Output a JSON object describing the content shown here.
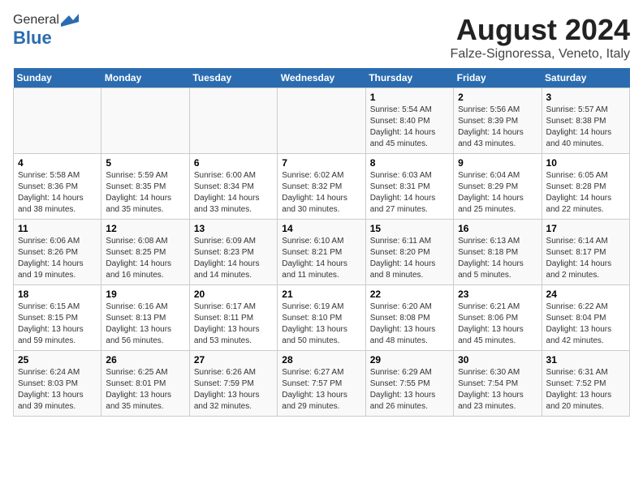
{
  "header": {
    "logo_general": "General",
    "logo_blue": "Blue",
    "main_title": "August 2024",
    "subtitle": "Falze-Signoressa, Veneto, Italy"
  },
  "calendar": {
    "days_of_week": [
      "Sunday",
      "Monday",
      "Tuesday",
      "Wednesday",
      "Thursday",
      "Friday",
      "Saturday"
    ],
    "weeks": [
      [
        {
          "day": "",
          "text": ""
        },
        {
          "day": "",
          "text": ""
        },
        {
          "day": "",
          "text": ""
        },
        {
          "day": "",
          "text": ""
        },
        {
          "day": "1",
          "text": "Sunrise: 5:54 AM\nSunset: 8:40 PM\nDaylight: 14 hours and 45 minutes."
        },
        {
          "day": "2",
          "text": "Sunrise: 5:56 AM\nSunset: 8:39 PM\nDaylight: 14 hours and 43 minutes."
        },
        {
          "day": "3",
          "text": "Sunrise: 5:57 AM\nSunset: 8:38 PM\nDaylight: 14 hours and 40 minutes."
        }
      ],
      [
        {
          "day": "4",
          "text": "Sunrise: 5:58 AM\nSunset: 8:36 PM\nDaylight: 14 hours and 38 minutes."
        },
        {
          "day": "5",
          "text": "Sunrise: 5:59 AM\nSunset: 8:35 PM\nDaylight: 14 hours and 35 minutes."
        },
        {
          "day": "6",
          "text": "Sunrise: 6:00 AM\nSunset: 8:34 PM\nDaylight: 14 hours and 33 minutes."
        },
        {
          "day": "7",
          "text": "Sunrise: 6:02 AM\nSunset: 8:32 PM\nDaylight: 14 hours and 30 minutes."
        },
        {
          "day": "8",
          "text": "Sunrise: 6:03 AM\nSunset: 8:31 PM\nDaylight: 14 hours and 27 minutes."
        },
        {
          "day": "9",
          "text": "Sunrise: 6:04 AM\nSunset: 8:29 PM\nDaylight: 14 hours and 25 minutes."
        },
        {
          "day": "10",
          "text": "Sunrise: 6:05 AM\nSunset: 8:28 PM\nDaylight: 14 hours and 22 minutes."
        }
      ],
      [
        {
          "day": "11",
          "text": "Sunrise: 6:06 AM\nSunset: 8:26 PM\nDaylight: 14 hours and 19 minutes."
        },
        {
          "day": "12",
          "text": "Sunrise: 6:08 AM\nSunset: 8:25 PM\nDaylight: 14 hours and 16 minutes."
        },
        {
          "day": "13",
          "text": "Sunrise: 6:09 AM\nSunset: 8:23 PM\nDaylight: 14 hours and 14 minutes."
        },
        {
          "day": "14",
          "text": "Sunrise: 6:10 AM\nSunset: 8:21 PM\nDaylight: 14 hours and 11 minutes."
        },
        {
          "day": "15",
          "text": "Sunrise: 6:11 AM\nSunset: 8:20 PM\nDaylight: 14 hours and 8 minutes."
        },
        {
          "day": "16",
          "text": "Sunrise: 6:13 AM\nSunset: 8:18 PM\nDaylight: 14 hours and 5 minutes."
        },
        {
          "day": "17",
          "text": "Sunrise: 6:14 AM\nSunset: 8:17 PM\nDaylight: 14 hours and 2 minutes."
        }
      ],
      [
        {
          "day": "18",
          "text": "Sunrise: 6:15 AM\nSunset: 8:15 PM\nDaylight: 13 hours and 59 minutes."
        },
        {
          "day": "19",
          "text": "Sunrise: 6:16 AM\nSunset: 8:13 PM\nDaylight: 13 hours and 56 minutes."
        },
        {
          "day": "20",
          "text": "Sunrise: 6:17 AM\nSunset: 8:11 PM\nDaylight: 13 hours and 53 minutes."
        },
        {
          "day": "21",
          "text": "Sunrise: 6:19 AM\nSunset: 8:10 PM\nDaylight: 13 hours and 50 minutes."
        },
        {
          "day": "22",
          "text": "Sunrise: 6:20 AM\nSunset: 8:08 PM\nDaylight: 13 hours and 48 minutes."
        },
        {
          "day": "23",
          "text": "Sunrise: 6:21 AM\nSunset: 8:06 PM\nDaylight: 13 hours and 45 minutes."
        },
        {
          "day": "24",
          "text": "Sunrise: 6:22 AM\nSunset: 8:04 PM\nDaylight: 13 hours and 42 minutes."
        }
      ],
      [
        {
          "day": "25",
          "text": "Sunrise: 6:24 AM\nSunset: 8:03 PM\nDaylight: 13 hours and 39 minutes."
        },
        {
          "day": "26",
          "text": "Sunrise: 6:25 AM\nSunset: 8:01 PM\nDaylight: 13 hours and 35 minutes."
        },
        {
          "day": "27",
          "text": "Sunrise: 6:26 AM\nSunset: 7:59 PM\nDaylight: 13 hours and 32 minutes."
        },
        {
          "day": "28",
          "text": "Sunrise: 6:27 AM\nSunset: 7:57 PM\nDaylight: 13 hours and 29 minutes."
        },
        {
          "day": "29",
          "text": "Sunrise: 6:29 AM\nSunset: 7:55 PM\nDaylight: 13 hours and 26 minutes."
        },
        {
          "day": "30",
          "text": "Sunrise: 6:30 AM\nSunset: 7:54 PM\nDaylight: 13 hours and 23 minutes."
        },
        {
          "day": "31",
          "text": "Sunrise: 6:31 AM\nSunset: 7:52 PM\nDaylight: 13 hours and 20 minutes."
        }
      ]
    ]
  }
}
